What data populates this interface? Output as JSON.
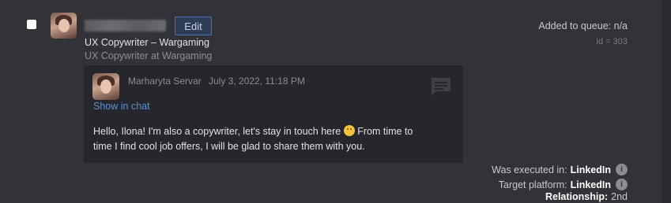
{
  "person": {
    "edit_label": "Edit",
    "headline": "UX Copywriter – Wargaming",
    "position": "UX Copywriter at Wargaming",
    "added_to_queue": "Added to queue: n/a",
    "id_text": "id = 303"
  },
  "message": {
    "author": "Marharyta Servar",
    "date": "July 3, 2022, 11:18 PM",
    "show_in_chat": "Show in chat",
    "text_before_emoji": "Hello, Ilona! I'm also a copywriter, let's stay in touch here",
    "text_after_emoji": "From time to time I find cool job offers, I will be glad to share them with you."
  },
  "meta": {
    "executed_label": "Was executed in:",
    "executed_value": "LinkedIn",
    "target_label": "Target platform:",
    "target_value": "LinkedIn",
    "relationship_label": "Relationship:",
    "relationship_value": "2nd",
    "info_glyph": "i"
  },
  "colors": {
    "background": "#323338",
    "card": "#25272c",
    "link": "#5b8fd8",
    "edit_border": "#4a6fb4"
  }
}
